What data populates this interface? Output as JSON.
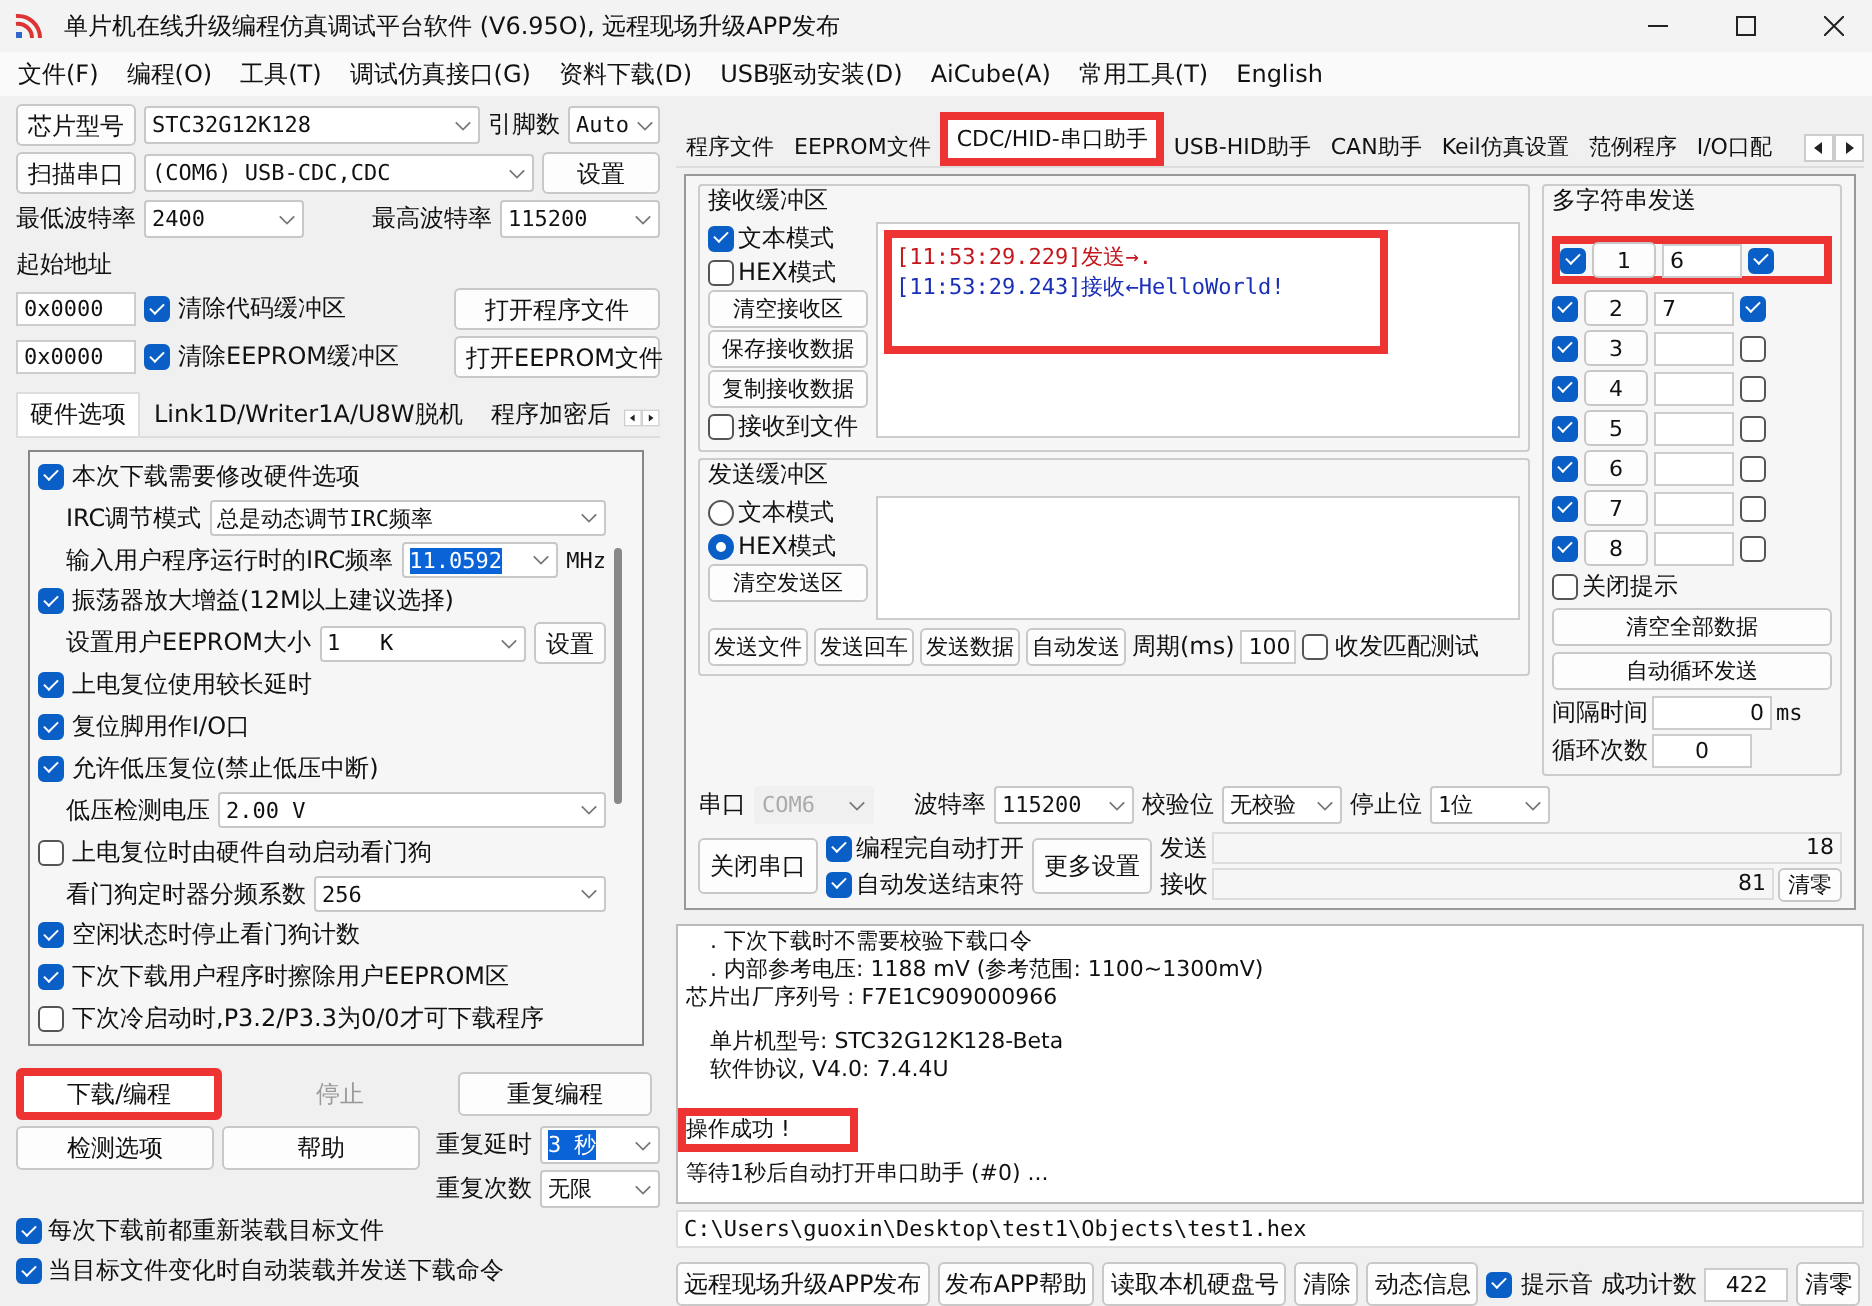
{
  "window": {
    "title": "单片机在线升级编程仿真调试平台软件 (V6.95O), 远程现场升级APP发布"
  },
  "menu": [
    "文件(F)",
    "编程(O)",
    "工具(T)",
    "调试仿真接口(G)",
    "资料下载(D)",
    "USB驱动安装(D)",
    "AiCube(A)",
    "常用工具(T)",
    "English"
  ],
  "left": {
    "chip": {
      "button": "芯片型号",
      "value": "STC32G12K128",
      "pins_label": "引脚数",
      "pins_value": "Auto"
    },
    "port": {
      "button": "扫描串口",
      "value": "(COM6) USB-CDC,CDC",
      "settings": "设置"
    },
    "baud": {
      "min_label": "最低波特率",
      "min_value": "2400",
      "max_label": "最高波特率",
      "max_value": "115200"
    },
    "start_label": "起始地址",
    "address_rows": [
      {
        "value": "0x0000",
        "label": "清除代码缓冲区",
        "checked": true,
        "button": "打开程序文件"
      },
      {
        "value": "0x0000",
        "label": "清除EEPROM缓冲区",
        "checked": true,
        "button": "打开EEPROM文件"
      }
    ],
    "tabs": [
      {
        "label": "硬件选项",
        "selected": true
      },
      {
        "label": "Link1D/Writer1A/U8W脱机",
        "selected": false
      },
      {
        "label": "程序加密后",
        "selected": false
      }
    ],
    "options": [
      {
        "kind": "check",
        "label": "本次下载需要修改硬件选项",
        "checked": true
      },
      {
        "kind": "select",
        "label": "IRC调节模式",
        "value": "总是动态调节IRC频率"
      },
      {
        "kind": "select",
        "label": "输入用户程序运行时的IRC频率",
        "value": "11.0592",
        "text_selected": true,
        "unit": "MHz"
      },
      {
        "kind": "check",
        "label": "振荡器放大增益(12M以上建议选择)",
        "checked": true
      },
      {
        "kind": "select",
        "label": "设置用户EEPROM大小",
        "value": "1   K",
        "button": "设置"
      },
      {
        "kind": "check",
        "label": "上电复位使用较长延时",
        "checked": true
      },
      {
        "kind": "check",
        "label": "复位脚用作I/O口",
        "checked": true
      },
      {
        "kind": "check",
        "label": "允许低压复位(禁止低压中断)",
        "checked": true
      },
      {
        "kind": "select",
        "label": "低压检测电压",
        "value": "2.00 V"
      },
      {
        "kind": "check",
        "label": "上电复位时由硬件自动启动看门狗",
        "checked": false
      },
      {
        "kind": "select",
        "label": "看门狗定时器分频系数",
        "value": "256"
      },
      {
        "kind": "check",
        "label": "空闲状态时停止看门狗计数",
        "checked": true
      },
      {
        "kind": "check",
        "label": "下次下载用户程序时擦除用户EEPROM区",
        "checked": true
      },
      {
        "kind": "check",
        "label": "下次冷启动时,P3.2/P3.3为0/0才可下载程序",
        "checked": false
      }
    ],
    "actions": [
      {
        "label": "下载/编程",
        "disabled": false,
        "highlighted": true
      },
      {
        "label": "停止",
        "disabled": true,
        "highlighted": false
      },
      {
        "label": "重复编程",
        "disabled": false,
        "highlighted": false
      }
    ],
    "actions2": [
      {
        "label": "检测选项"
      },
      {
        "label": "帮助"
      }
    ],
    "repeat": [
      {
        "label": "重复延时",
        "value": "3 秒",
        "text_selected": true
      },
      {
        "label": "重复次数",
        "value": "无限",
        "text_selected": false
      }
    ],
    "bottom_checks": [
      {
        "label": "每次下载前都重新装载目标文件",
        "checked": true
      },
      {
        "label": "当目标文件变化时自动装载并发送下载命令",
        "checked": true
      }
    ]
  },
  "right": {
    "tabs": [
      {
        "label": "程序文件",
        "selected": false,
        "highlighted": false
      },
      {
        "label": "EEPROM文件",
        "selected": false,
        "highlighted": false
      },
      {
        "label": "CDC/HID-串口助手",
        "selected": true,
        "highlighted": true
      },
      {
        "label": "USB-HID助手",
        "selected": false,
        "highlighted": false
      },
      {
        "label": "CAN助手",
        "selected": false,
        "highlighted": false
      },
      {
        "label": "Keil仿真设置",
        "selected": false,
        "highlighted": false
      },
      {
        "label": "范例程序",
        "selected": false,
        "highlighted": false
      },
      {
        "label": "I/O口配",
        "selected": false,
        "highlighted": false
      }
    ],
    "receive": {
      "title": "接收缓冲区",
      "modes": [
        {
          "label": "文本模式",
          "checked": true
        },
        {
          "label": "HEX模式",
          "checked": false
        }
      ],
      "buttons": [
        "清空接收区",
        "保存接收数据",
        "复制接收数据"
      ],
      "to_file": {
        "label": "接收到文件",
        "checked": false
      },
      "highlighted": true,
      "lines": [
        {
          "kind": "sent",
          "text": "[11:53:29.229]发送→."
        },
        {
          "kind": "received",
          "text": "[11:53:29.243]接收←HelloWorld!"
        }
      ]
    },
    "send": {
      "title": "发送缓冲区",
      "modes": [
        {
          "label": "文本模式",
          "selected": false
        },
        {
          "label": "HEX模式",
          "selected": true
        }
      ],
      "clear": "清空发送区",
      "buttons": [
        "发送文件",
        "发送回车",
        "发送数据",
        "自动发送"
      ],
      "period_label": "周期(ms)",
      "period_value": "100",
      "match": {
        "label": "收发匹配测试",
        "checked": false
      }
    },
    "multi": {
      "title": "多字符串发送",
      "rows": [
        {
          "index": "1",
          "value": "6",
          "send": true,
          "hex": true,
          "highlighted": true
        },
        {
          "index": "2",
          "value": "7",
          "send": true,
          "hex": true,
          "highlighted": false
        },
        {
          "index": "3",
          "send": true,
          "hex": false,
          "highlighted": false
        },
        {
          "index": "4",
          "send": true,
          "hex": false,
          "highlighted": false
        },
        {
          "index": "5",
          "send": true,
          "hex": false,
          "highlighted": false
        },
        {
          "index": "6",
          "send": true,
          "hex": false,
          "highlighted": false
        },
        {
          "index": "7",
          "send": true,
          "hex": false,
          "highlighted": false
        },
        {
          "index": "8",
          "send": true,
          "hex": false,
          "highlighted": false
        }
      ],
      "close_hint": {
        "label": "关闭提示",
        "checked": false
      },
      "buttons": [
        "清空全部数据",
        "自动循环发送"
      ],
      "interval_label": "间隔时间",
      "interval_value": "0",
      "interval_unit": "ms",
      "loop_label": "循环次数",
      "loop_value": "0"
    },
    "serial": {
      "port_label": "串口",
      "port_value": "COM6",
      "baud_label": "波特率",
      "baud_value": "115200",
      "parity_label": "校验位",
      "parity_value": "无校验",
      "stop_label": "停止位",
      "stop_value": "1位",
      "close": "关闭串口",
      "checks": [
        {
          "label": "编程完自动打开",
          "checked": true
        },
        {
          "label": "自动发送结束符",
          "checked": true
        }
      ],
      "more": "更多设置",
      "sent_label": "发送",
      "sent_value": "18",
      "recv_label": "接收",
      "recv_value": "81",
      "clear": "清零"
    },
    "log": [
      {
        "kind": "indented",
        "text": ". 下次下载时不需要校验下载口令",
        "highlighted": false
      },
      {
        "kind": "indented",
        "text": ". 内部参考电压: 1188 mV (参考范围: 1100~1300mV)",
        "highlighted": false
      },
      {
        "kind": "plain",
        "text": "芯片出厂序列号 : F7E1C909000966",
        "highlighted": false
      },
      {
        "kind": "blank"
      },
      {
        "kind": "indented",
        "text": "单片机型号: STC32G12K128-Beta",
        "highlighted": false
      },
      {
        "kind": "indented",
        "text": "软件协议, V4.0: 7.4.4U",
        "highlighted": false
      },
      {
        "kind": "blank"
      },
      {
        "kind": "blank"
      },
      {
        "kind": "plain",
        "text": "操作成功 !",
        "highlighted": true
      },
      {
        "kind": "blank"
      },
      {
        "kind": "plain",
        "text": "等待1秒后自动打开串口助手 (#0) ...",
        "highlighted": false
      }
    ],
    "path": "C:\\Users\\guoxin\\Desktop\\test1\\Objects\\test1.hex",
    "bottom_buttons": [
      "远程现场升级APP发布",
      "发布APP帮助",
      "读取本机硬盘号",
      "清除",
      "动态信息"
    ],
    "beep": {
      "label": "提示音",
      "checked": true
    },
    "count_label": "成功计数",
    "count_value": "422",
    "count_clear": "清零"
  }
}
